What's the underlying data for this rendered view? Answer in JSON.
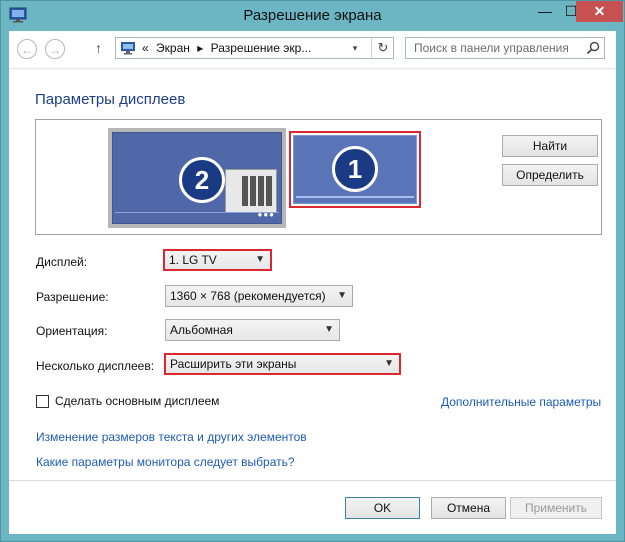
{
  "window": {
    "title": "Разрешение экрана",
    "min_label": "—",
    "max_label": "☐",
    "close_label": "✕"
  },
  "nav": {
    "back_glyph": "←",
    "forward_glyph": "→",
    "up_glyph": "↑",
    "breadcrumb_prefix": "«",
    "crumbs": [
      "Экран",
      "▸",
      "Разрешение экр..."
    ],
    "dropdown_glyph": "▾",
    "refresh_glyph": "↻",
    "search_placeholder": "Поиск в панели управления"
  },
  "main": {
    "heading": "Параметры дисплеев",
    "monitors": [
      {
        "number": "2"
      },
      {
        "number": "1"
      }
    ],
    "find_button": "Найти",
    "identify_button": "Определить",
    "display_label": "Дисплей:",
    "display_value": "1. LG TV",
    "resolution_label": "Разрешение:",
    "resolution_value": "1360 × 768 (рекомендуется)",
    "orientation_label": "Ориентация:",
    "orientation_value": "Альбомная",
    "multi_label": "Несколько дисплеев:",
    "multi_value": "Расширить эти экраны",
    "primary_checkbox_label": "Сделать основным дисплеем",
    "advanced_link": "Дополнительные параметры",
    "text_size_link": "Изменение размеров текста и других элементов",
    "which_settings_link": "Какие параметры монитора следует выбрать?"
  },
  "footer": {
    "ok": "OK",
    "cancel": "Отмена",
    "apply": "Применить"
  },
  "colors": {
    "accent_highlight": "#d9282f",
    "link": "#1e5cb4",
    "heading": "#1e3e8c",
    "monitor_screen": "#5168a8",
    "chrome": "#6cb6c4"
  },
  "icons": [
    "display-app-icon",
    "display-address-icon",
    "search-icon",
    "close-icon",
    "minimize-icon",
    "maximize-icon",
    "back-icon",
    "forward-icon",
    "up-icon",
    "refresh-icon",
    "chevron-down-icon"
  ]
}
